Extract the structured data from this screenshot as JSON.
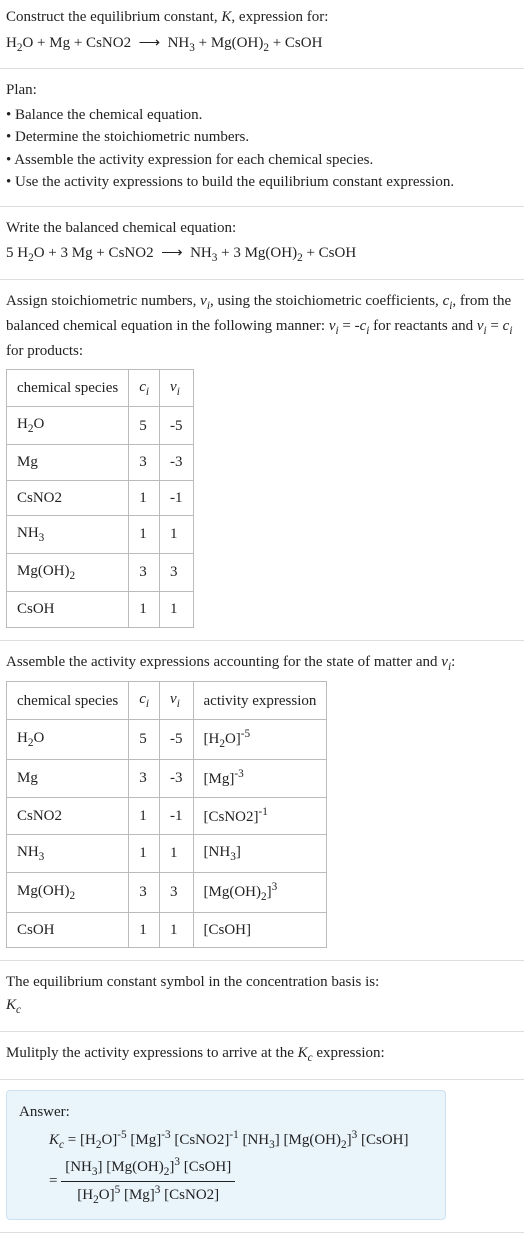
{
  "intro": {
    "line1": "Construct the equilibrium constant, K, expression for:",
    "equation": "H₂O + Mg + CsNO2  ⟶  NH₃ + Mg(OH)₂ + CsOH"
  },
  "plan": {
    "title": "Plan:",
    "items": [
      "Balance the chemical equation.",
      "Determine the stoichiometric numbers.",
      "Assemble the activity expression for each chemical species.",
      "Use the activity expressions to build the equilibrium constant expression."
    ]
  },
  "balanced": {
    "lead": "Write the balanced chemical equation:",
    "equation": "5 H₂O + 3 Mg + CsNO2  ⟶  NH₃ + 3 Mg(OH)₂ + CsOH"
  },
  "assign": {
    "lead": "Assign stoichiometric numbers, νᵢ, using the stoichiometric coefficients, cᵢ, from the balanced chemical equation in the following manner: νᵢ = -cᵢ for reactants and νᵢ = cᵢ for products:",
    "headers": [
      "chemical species",
      "cᵢ",
      "νᵢ"
    ],
    "rows": [
      {
        "sp": "H₂O",
        "c": "5",
        "v": "-5"
      },
      {
        "sp": "Mg",
        "c": "3",
        "v": "-3"
      },
      {
        "sp": "CsNO2",
        "c": "1",
        "v": "-1"
      },
      {
        "sp": "NH₃",
        "c": "1",
        "v": "1"
      },
      {
        "sp": "Mg(OH)₂",
        "c": "3",
        "v": "3"
      },
      {
        "sp": "CsOH",
        "c": "1",
        "v": "1"
      }
    ]
  },
  "assemble": {
    "lead": "Assemble the activity expressions accounting for the state of matter and νᵢ:",
    "headers": [
      "chemical species",
      "cᵢ",
      "νᵢ",
      "activity expression"
    ],
    "rows": [
      {
        "sp": "H₂O",
        "c": "5",
        "v": "-5",
        "ae": "[H₂O]⁻⁵"
      },
      {
        "sp": "Mg",
        "c": "3",
        "v": "-3",
        "ae": "[Mg]⁻³"
      },
      {
        "sp": "CsNO2",
        "c": "1",
        "v": "-1",
        "ae": "[CsNO2]⁻¹"
      },
      {
        "sp": "NH₃",
        "c": "1",
        "v": "1",
        "ae": "[NH₃]"
      },
      {
        "sp": "Mg(OH)₂",
        "c": "3",
        "v": "3",
        "ae": "[Mg(OH)₂]³"
      },
      {
        "sp": "CsOH",
        "c": "1",
        "v": "1",
        "ae": "[CsOH]"
      }
    ]
  },
  "kcdef": {
    "lead": "The equilibrium constant symbol in the concentration basis is:",
    "sym": "K_c"
  },
  "mult": {
    "lead": "Mulitply the activity expressions to arrive at the K_c expression:"
  },
  "answer": {
    "title": "Answer:",
    "line1": "K_c = [H₂O]⁻⁵ [Mg]⁻³ [CsNO2]⁻¹ [NH₃] [Mg(OH)₂]³ [CsOH]",
    "eqsign": "=",
    "num": "[NH₃] [Mg(OH)₂]³ [CsOH]",
    "den": "[H₂O]⁵ [Mg]³ [CsNO2]"
  }
}
